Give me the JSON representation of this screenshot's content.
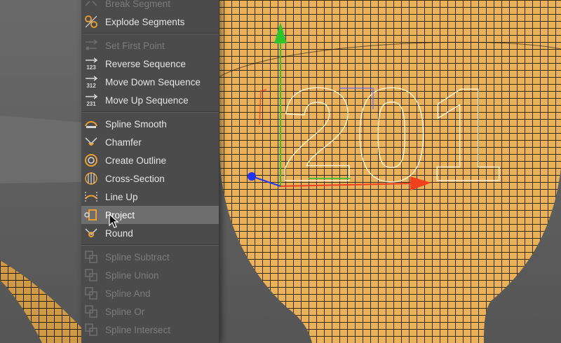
{
  "menu": {
    "items": [
      {
        "label": "Break Segment",
        "icon": "break-segment-icon",
        "enabled": false
      },
      {
        "label": "Explode Segments",
        "icon": "explode-segments-icon",
        "enabled": true
      },
      {
        "label": "Set First Point",
        "icon": "set-first-point-icon",
        "enabled": false
      },
      {
        "label": "Reverse Sequence",
        "icon": "reverse-sequence-icon",
        "enabled": true,
        "icon_text": "123"
      },
      {
        "label": "Move Down Sequence",
        "icon": "move-down-sequence-icon",
        "enabled": true,
        "icon_text": "312"
      },
      {
        "label": "Move Up Sequence",
        "icon": "move-up-sequence-icon",
        "enabled": true,
        "icon_text": "231"
      },
      {
        "label": "Spline Smooth",
        "icon": "spline-smooth-icon",
        "enabled": true
      },
      {
        "label": "Chamfer",
        "icon": "chamfer-icon",
        "enabled": true
      },
      {
        "label": "Create Outline",
        "icon": "create-outline-icon",
        "enabled": true
      },
      {
        "label": "Cross-Section",
        "icon": "cross-section-icon",
        "enabled": true
      },
      {
        "label": "Line Up",
        "icon": "line-up-icon",
        "enabled": true
      },
      {
        "label": "Project",
        "icon": "project-icon",
        "enabled": true,
        "highlighted": true
      },
      {
        "label": "Round",
        "icon": "round-icon",
        "enabled": true
      },
      {
        "label": "Spline Subtract",
        "icon": "spline-subtract-icon",
        "enabled": false
      },
      {
        "label": "Spline Union",
        "icon": "spline-union-icon",
        "enabled": false
      },
      {
        "label": "Spline And",
        "icon": "spline-and-icon",
        "enabled": false
      },
      {
        "label": "Spline Or",
        "icon": "spline-or-icon",
        "enabled": false
      },
      {
        "label": "Spline Intersect",
        "icon": "spline-intersect-icon",
        "enabled": false
      }
    ]
  },
  "viewport": {
    "spline_text": "201",
    "colors": {
      "background": "#5e5e5e",
      "mesh_fill": "#e8b15a",
      "mesh_lines": "#1a1408",
      "spline": "#fff3d6",
      "axis_x": "#f0401e",
      "axis_y": "#2ec42e",
      "axis_z": "#2233ee"
    }
  },
  "cursor": {
    "icon": "arrow-cursor-icon"
  }
}
